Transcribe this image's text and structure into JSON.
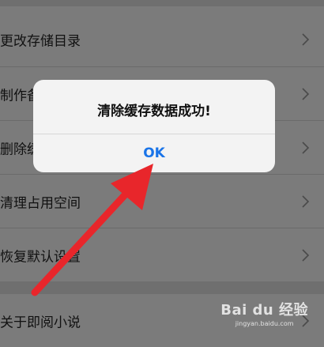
{
  "settings": {
    "items": [
      {
        "label": "更改存储目录"
      },
      {
        "label": "制作备"
      },
      {
        "label": "删除缓"
      },
      {
        "label": "清理占用空间"
      },
      {
        "label": "恢复默认设置"
      },
      {
        "label": "关于即阅小说"
      }
    ]
  },
  "alert": {
    "message": "清除缓存数据成功!",
    "ok_label": "OK"
  },
  "annotation": {
    "arrow_color": "#e8262b"
  },
  "watermark": {
    "brand": "Bai du 经验",
    "sub": "jingyan.baidu.com"
  }
}
